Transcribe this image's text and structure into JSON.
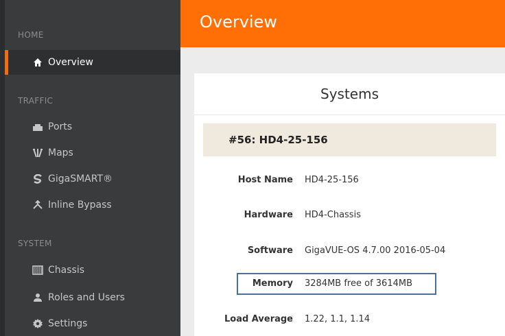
{
  "sidebar": {
    "sections": [
      {
        "label": "HOME"
      },
      {
        "label": "TRAFFIC"
      },
      {
        "label": "SYSTEM"
      }
    ],
    "items": [
      {
        "label": "Overview",
        "icon": "home-icon"
      },
      {
        "label": "Ports",
        "icon": "ports-icon"
      },
      {
        "label": "Maps",
        "icon": "maps-icon"
      },
      {
        "label": "GigaSMART®",
        "icon": "gigasmart-icon"
      },
      {
        "label": "Inline Bypass",
        "icon": "inline-bypass-icon"
      },
      {
        "label": "Chassis",
        "icon": "chassis-icon"
      },
      {
        "label": "Roles and Users",
        "icon": "user-icon"
      },
      {
        "label": "Settings",
        "icon": "gear-icon"
      }
    ]
  },
  "header": {
    "title": "Overview"
  },
  "main": {
    "card_title": "Systems",
    "system_name": "#56: HD4-25-156",
    "details": [
      {
        "key": "Host Name",
        "value": "HD4-25-156"
      },
      {
        "key": "Hardware",
        "value": "HD4-Chassis"
      },
      {
        "key": "Software",
        "value": "GigaVUE-OS 4.7.00 2016-05-04"
      },
      {
        "key": "Memory",
        "value": "3284MB free of 3614MB"
      },
      {
        "key": "Load Average",
        "value": "1.22, 1.1, 1.14"
      }
    ]
  },
  "colors": {
    "accent": "#ff6f06",
    "sidebar_bg": "#3a3b3c",
    "system_bar_bg": "#efeadd",
    "highlight_border": "#4c6e9c"
  }
}
